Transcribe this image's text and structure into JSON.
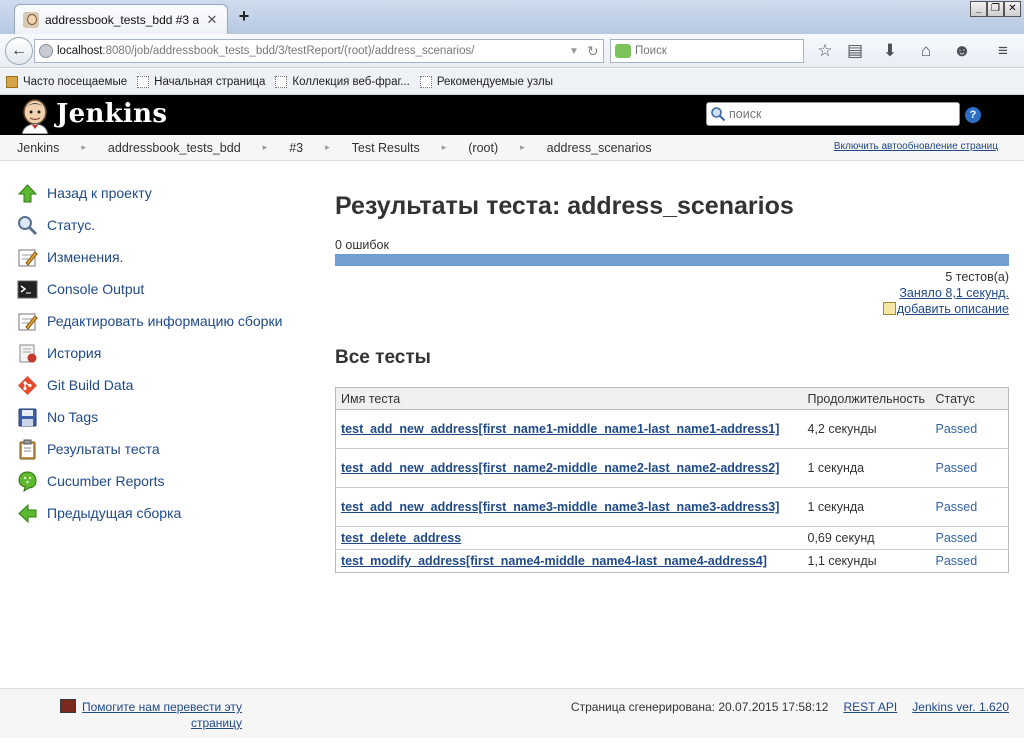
{
  "browser": {
    "tab_title": "addressbook_tests_bdd #3 a...",
    "tab_close": "✕",
    "new_tab": "+",
    "window": {
      "min": "_",
      "max": "❐",
      "close": "✕"
    },
    "url_host": "localhost",
    "url_rest": ":8080/job/addressbook_tests_bdd/3/testReport/(root)/address_scenarios/",
    "search_placeholder": "Поиск",
    "bookmarks": [
      "Часто посещаемые",
      "Начальная страница",
      "Коллекция веб-фраг...",
      "Рекомендуемые узлы"
    ]
  },
  "jenkins": {
    "title": "Jenkins",
    "search_placeholder": "поиск",
    "help": "?",
    "breadcrumbs": [
      "Jenkins",
      "addressbook_tests_bdd",
      "#3",
      "Test Results",
      "(root)",
      "address_scenarios"
    ],
    "autorefresh": "Включить автообновление страниц"
  },
  "sidebar": {
    "items": [
      {
        "label": "Назад к проекту",
        "icon": "up-arrow-icon"
      },
      {
        "label": "Статус.",
        "icon": "magnifier-icon"
      },
      {
        "label": "Изменения.",
        "icon": "notepad-icon"
      },
      {
        "label": "Console Output",
        "icon": "terminal-icon"
      },
      {
        "label": "Редактировать информацию сборки",
        "icon": "notepad-edit-icon"
      },
      {
        "label": "История",
        "icon": "history-icon"
      },
      {
        "label": "Git Build Data",
        "icon": "git-icon"
      },
      {
        "label": "No Tags",
        "icon": "floppy-icon"
      },
      {
        "label": "Результаты теста",
        "icon": "clipboard-icon"
      },
      {
        "label": "Cucumber Reports",
        "icon": "cucumber-icon"
      },
      {
        "label": "Предыдущая сборка",
        "icon": "left-arrow-icon"
      }
    ]
  },
  "main": {
    "title": "Результаты теста: address_scenarios",
    "fail_count": "0 ошибок",
    "test_count": "5 тестов(а)",
    "duration": "Заняло 8,1 секунд.",
    "add_description": "добавить описание",
    "section_title": "Все тесты",
    "table": {
      "headers": [
        "Имя теста",
        "Продолжительность",
        "Статус"
      ],
      "rows": [
        {
          "name": "test_add_new_address[first_name1-middle_name1-last_name1-address1]",
          "duration": "4,2 секунды",
          "status": "Passed"
        },
        {
          "name": "test_add_new_address[first_name2-middle_name2-last_name2-address2]",
          "duration": "1 секунда",
          "status": "Passed"
        },
        {
          "name": "test_add_new_address[first_name3-middle_name3-last_name3-address3]",
          "duration": "1 секунда",
          "status": "Passed"
        },
        {
          "name": "test_delete_address",
          "duration": "0,69 секунд",
          "status": "Passed"
        },
        {
          "name": "test_modify_address[first_name4-middle_name4-last_name4-address4]",
          "duration": "1,1 секунды",
          "status": "Passed"
        }
      ]
    }
  },
  "footer": {
    "translate": "Помогите нам перевести эту страницу",
    "generated": "Страница сгенерирована: 20.07.2015 17:58:12",
    "rest_api": "REST API",
    "version": "Jenkins ver. 1.620"
  },
  "colors": {
    "progress_pass": "#729fcf",
    "link": "#204a87",
    "header_bg": "#000000"
  }
}
